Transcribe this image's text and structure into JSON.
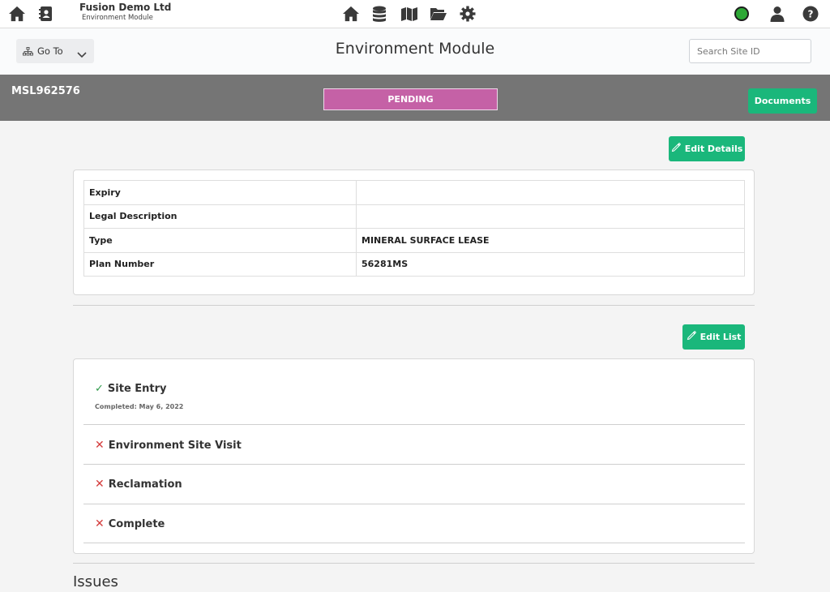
{
  "topbar": {
    "company": "Fusion Demo Ltd",
    "module": "Environment Module",
    "status_color": "#2ea836"
  },
  "header": {
    "goto_label": "Go To",
    "title": "Environment Module",
    "search_placeholder": "Search Site ID"
  },
  "site": {
    "id": "MSL962576",
    "status": "PENDING",
    "status_color": "#c561a6",
    "documents_label": "Documents"
  },
  "details": {
    "edit_label": "Edit Details",
    "rows": [
      {
        "label": "Expiry",
        "value": ""
      },
      {
        "label": "Legal Description",
        "value": ""
      },
      {
        "label": "Type",
        "value": "MINERAL SURFACE LEASE"
      },
      {
        "label": "Plan Number",
        "value": "56281MS"
      }
    ]
  },
  "checklist": {
    "edit_label": "Edit List",
    "items": [
      {
        "title": "Site Entry",
        "done": true,
        "sub": "Completed: May 6, 2022",
        "mark": "✓"
      },
      {
        "title": "Environment Site Visit",
        "done": false,
        "sub": "",
        "mark": "✕"
      },
      {
        "title": "Reclamation",
        "done": false,
        "sub": "",
        "mark": "✕"
      },
      {
        "title": "Complete",
        "done": false,
        "sub": "",
        "mark": "✕"
      }
    ]
  },
  "issues": {
    "heading": "Issues"
  },
  "colors": {
    "accent_green": "#1ab77b",
    "gray_bar": "#757575"
  }
}
